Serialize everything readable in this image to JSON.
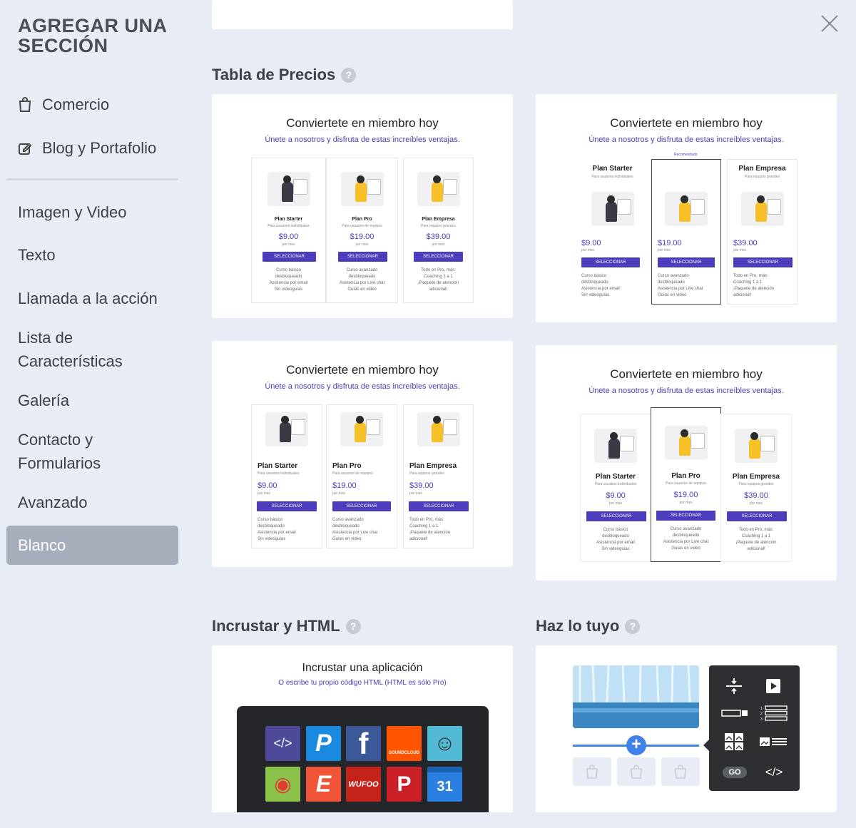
{
  "sidebar": {
    "title": "AGREGAR UNA SECCIÓN",
    "items": [
      {
        "label": "Comercio"
      },
      {
        "label": "Blog y Portafolio"
      },
      {
        "label": "Imagen y Video"
      },
      {
        "label": "Texto"
      },
      {
        "label": "Llamada a la acción"
      },
      {
        "label": "Lista de Características"
      },
      {
        "label": "Galería"
      },
      {
        "label": "Contacto y Formularios"
      },
      {
        "label": "Avanzado"
      },
      {
        "label": "Blanco"
      }
    ]
  },
  "sections": {
    "pricing": {
      "title": "Tabla de Precios"
    },
    "embed": {
      "title": "Incrustar y HTML"
    },
    "diy": {
      "title": "Haz lo tuyo"
    }
  },
  "preview": {
    "title": "Conviertete en miembro hoy",
    "subtitle": "Únete a nosotros y disfruta de estas increíbles ventajas.",
    "recommended": "Recomendado",
    "button": "SELECCIONAR",
    "per_month": "por mes",
    "plans": [
      {
        "name": "Plan Starter",
        "desc": "Para usuarios individuales",
        "price": "$9.00",
        "features": [
          "Curso básico",
          "desbloqueado",
          "Asistencia por email",
          "Sin videoguías"
        ]
      },
      {
        "name": "Plan Pro",
        "desc": "Para usuarios de equipos",
        "price": "$19.00",
        "features": [
          "Curso avanzado",
          "desbloqueado",
          "Asistencia por Live chat",
          "Guías en video"
        ]
      },
      {
        "name": "Plan Empresa",
        "desc": "Para equipos grandes",
        "price": "$39.00",
        "features": [
          "Todo en Pro, más:",
          "Coaching 1 a 1",
          "¡Paquete de atención",
          "adicional!"
        ]
      }
    ]
  },
  "embed": {
    "title": "Incrustar una aplicación",
    "subtitle": "O escribe tu propio código HTML (HTML es sólo Pro)",
    "apps": [
      {
        "icon": "code-icon",
        "color": "#4d4a9a",
        "glyph": "</>"
      },
      {
        "icon": "paypal-icon",
        "color": "#1a8ae0",
        "glyph": "P"
      },
      {
        "icon": "facebook-icon",
        "color": "#3b5998",
        "glyph": "f"
      },
      {
        "icon": "soundcloud-icon",
        "color": "#ff5500",
        "glyph": "SOUNDCLOUD"
      },
      {
        "icon": "mailchimp-icon",
        "color": "#52bad5",
        "glyph": "☺"
      },
      {
        "icon": "google-maps-icon",
        "color": "#8bc34a",
        "glyph": "◉"
      },
      {
        "icon": "eventbrite-icon",
        "color": "#f05537",
        "glyph": "E"
      },
      {
        "icon": "wufoo-icon",
        "color": "#c4231c",
        "glyph": "WUFOO"
      },
      {
        "icon": "pinterest-icon",
        "color": "#cb2027",
        "glyph": "P"
      },
      {
        "icon": "calendar-icon",
        "color": "#2a7fe0",
        "glyph": "31"
      }
    ]
  },
  "diy": {
    "go_label": "GO",
    "code_label": "</>"
  }
}
